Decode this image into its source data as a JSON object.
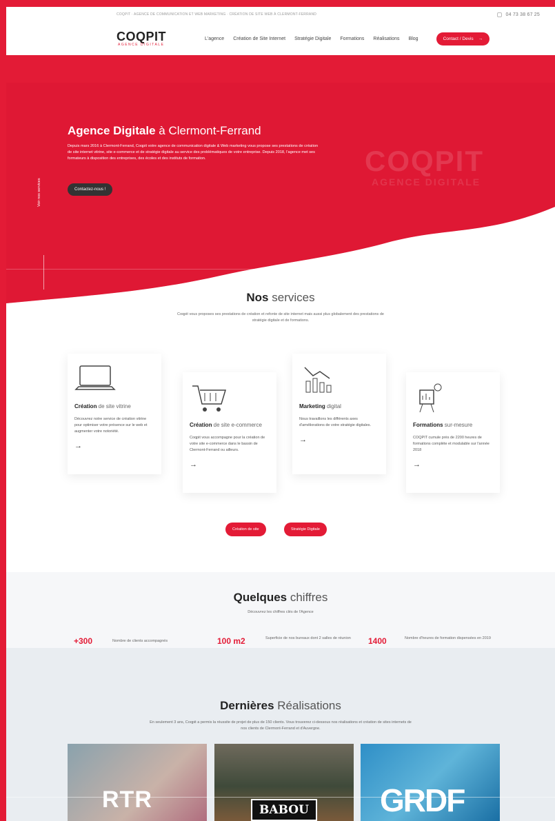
{
  "topbar": {
    "tagline": "COQPIT · AGENCE DE COMMUNICATION ET WEB MARKETING · CRÉATION DE SITE WEB À CLERMONT-FERRAND",
    "phone": "04 73 38 67 25"
  },
  "nav": {
    "logo": "COQPIT",
    "logo_sub": "AGENCE DIGITALE",
    "items": [
      "L'agence",
      "Création de Site Internet",
      "Stratégie Digitale",
      "Formations",
      "Réalisations",
      "Blog"
    ],
    "cta": "Contact / Devis"
  },
  "hero": {
    "title_bold": "Agence Digitale",
    "title_light": " à Clermont-Ferrand",
    "text": "Depuis mars 2016 à Clermont-Ferrand, Coqpit votre agence de communication digitale & Web marketing vous propose ses prestations de création de site internet vitrine, site e-commerce et de stratégie digitale au service des problématiques de votre entreprise. Depuis 2018, l'agence met ses formateurs à disposition des entreprises, des écoles et des instituts de formation.",
    "button": "Contactez-nous !",
    "side_label": "Voir nos services",
    "watermark": "COQPIT",
    "watermark_sub": "AGENCE DIGITALE"
  },
  "services": {
    "title_bold": "Nos",
    "title_light": " services",
    "subtitle": "Coqpit vous proposes ses prestations de création et refonte de site internet mais aussi plus globalement des prestations de stratégie digitale et de formations.",
    "cards": [
      {
        "title_bold": "Création",
        "title_light": " de site vitrine",
        "text": "Découvrez notre service de création vitrine pour optimiser votre présence sur le web et augmenter votre notoriété.",
        "icon": "laptop-icon"
      },
      {
        "title_bold": "Création",
        "title_light": " de site e-commerce",
        "text": "Coqpit vous accompagne pour la création de votre site e-commerce dans le bassin de Clermont-Ferrand ou ailleurs.",
        "icon": "cart-icon"
      },
      {
        "title_bold": "Marketing",
        "title_light": " digital",
        "text": "Nous travaillons les différents axes d'améliorations de votre stratégie digitales.",
        "icon": "chart-icon"
      },
      {
        "title_bold": "Formations",
        "title_light": " sur-mesure",
        "text": "COQPIT cumule près de 2200 heures de formations complète et modulable sur l'année 2018",
        "icon": "presentation-icon"
      }
    ],
    "arrow": "→",
    "buttons": [
      "Création de site",
      "Stratégie Digitale"
    ]
  },
  "figures": {
    "title_bold": "Quelques",
    "title_light": " chiffres",
    "subtitle": "Découvrez les chiffres clés de l'Agence",
    "stats": [
      {
        "value": "+300",
        "label": "Nombre de clients accompagnés"
      },
      {
        "value": "100 m2",
        "label": "Superficie de nos bureaux dont 2 salles de réunion"
      },
      {
        "value": "1400",
        "label": "Nombre d'heures de formation dispensées en 2019"
      }
    ]
  },
  "realisations": {
    "title_bold": "Dernières",
    "title_light": " Réalisations",
    "subtitle": "En seulement 3 ans, Coqpit a permis la réussite de projet de plus de 150 clients. Vous trouverez ci-dessous nos réalisations et création de sites internets de nos clients de Clermont-Ferrand et d'Auvergne.",
    "items": [
      "RTR",
      "BABOU",
      "GRDF"
    ]
  },
  "colors": {
    "brand": "#e31b36",
    "dark": "#333333"
  }
}
